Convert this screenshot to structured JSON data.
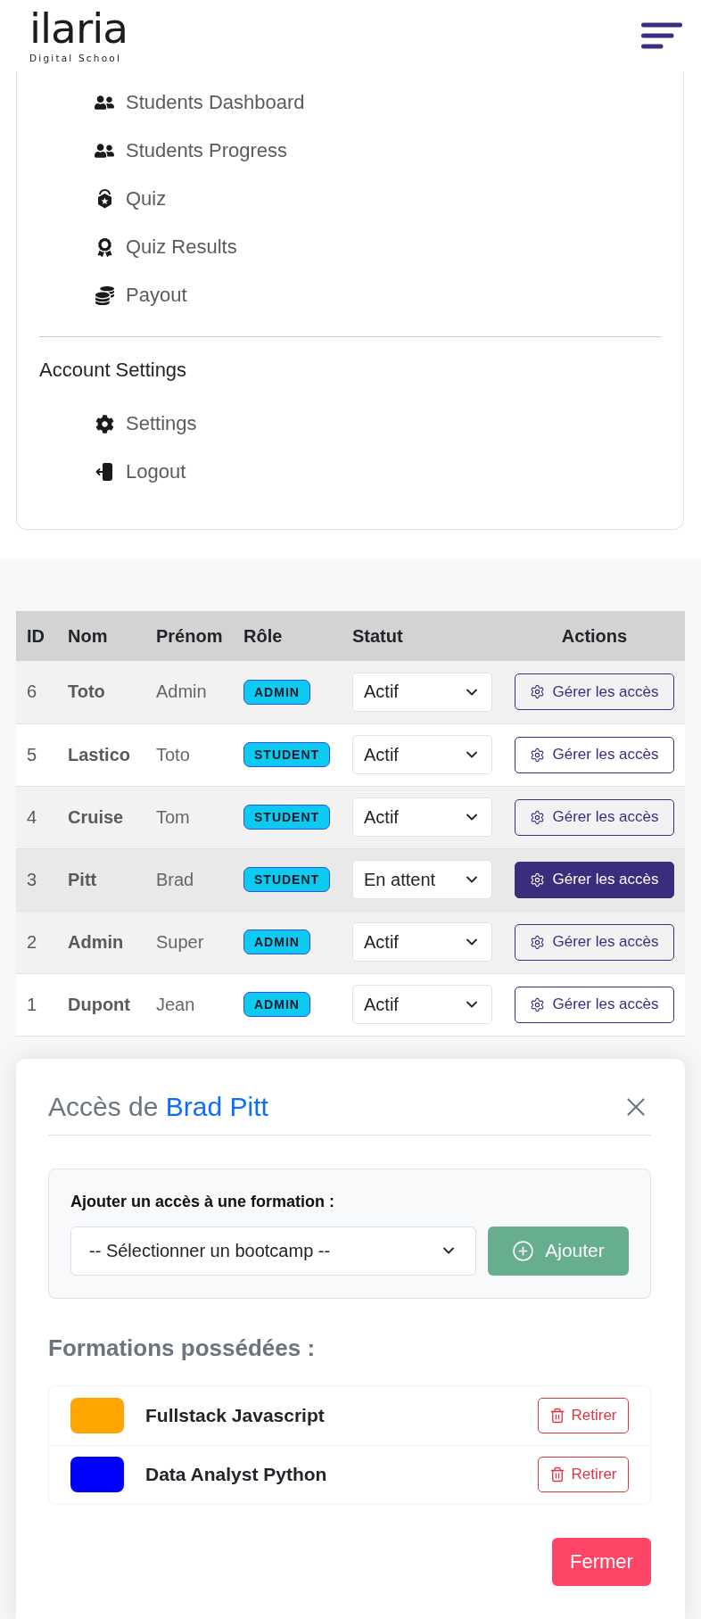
{
  "header": {
    "logo": {
      "name": "ilaria",
      "tagline": "Digital School"
    }
  },
  "menu": {
    "items": [
      {
        "label": "Students Dashboard"
      },
      {
        "label": "Students Progress"
      },
      {
        "label": "Quiz"
      },
      {
        "label": "Quiz Results"
      },
      {
        "label": "Payout"
      }
    ],
    "account_section": {
      "title": "Account Settings",
      "items": [
        {
          "label": "Settings"
        },
        {
          "label": "Logout"
        }
      ]
    }
  },
  "users_table": {
    "columns": [
      "ID",
      "Nom",
      "Prénom",
      "Rôle",
      "Statut",
      "Actions"
    ],
    "rows": [
      {
        "id": "6",
        "last_name": "Toto",
        "first_name": "Admin",
        "role": "ADMIN",
        "status": "Actif",
        "action": "Gérer les accès",
        "selected": false
      },
      {
        "id": "5",
        "last_name": "Lastico",
        "first_name": "Toto",
        "role": "STUDENT",
        "status": "Actif",
        "action": "Gérer les accès",
        "selected": false
      },
      {
        "id": "4",
        "last_name": "Cruise",
        "first_name": "Tom",
        "role": "STUDENT",
        "status": "Actif",
        "action": "Gérer les accès",
        "selected": false
      },
      {
        "id": "3",
        "last_name": "Pitt",
        "first_name": "Brad",
        "role": "STUDENT",
        "status": "En attent",
        "action": "Gérer les accès",
        "selected": true
      },
      {
        "id": "2",
        "last_name": "Admin",
        "first_name": "Super",
        "role": "ADMIN",
        "status": "Actif",
        "action": "Gérer les accès",
        "selected": false
      },
      {
        "id": "1",
        "last_name": "Dupont",
        "first_name": "Jean",
        "role": "ADMIN",
        "status": "Actif",
        "action": "Gérer les accès",
        "selected": false
      }
    ]
  },
  "access_modal": {
    "title": "Accès de",
    "title_highlight": "Brad Pitt",
    "add_section": {
      "label": "Ajouter un accès à une formation :",
      "select_placeholder": "-- Sélectionner un bootcamp --",
      "button": {
        "label": "Ajouter",
        "disabled": true
      }
    },
    "owned_heading": "Formations possédées :",
    "formations": [
      {
        "name": "Fullstack Javascript",
        "color": "#ffa500",
        "action": "Retirer"
      },
      {
        "name": "Data Analyst Python",
        "color": "#0000ff",
        "action": "Retirer"
      }
    ],
    "close_button": "Fermer"
  }
}
